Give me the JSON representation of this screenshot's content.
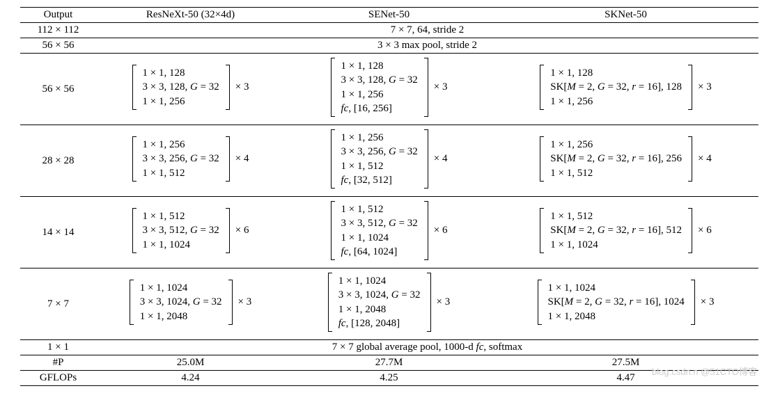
{
  "chart_data": {
    "type": "table",
    "columns": [
      "Output",
      "ResNeXt-50 (32×4d)",
      "SENet-50",
      "SKNet-50"
    ],
    "stem": {
      "output": "112 × 112",
      "op": "7 × 7, 64, stride 2"
    },
    "pool": {
      "output": "56 × 56",
      "op": "3 × 3 max pool, stride 2"
    },
    "stages": [
      {
        "output": "56 × 56",
        "repeat": 3,
        "resnext": [
          "1 × 1, 128",
          "3 × 3, 128, G = 32",
          "1 × 1, 256"
        ],
        "senet": [
          "1 × 1, 128",
          "3 × 3, 128, G = 32",
          "1 × 1, 256",
          "fc, [16, 256]"
        ],
        "sknet": [
          "1 × 1, 128",
          "SK[M = 2, G = 32, r = 16], 128",
          "1 × 1, 256"
        ]
      },
      {
        "output": "28 × 28",
        "repeat": 4,
        "resnext": [
          "1 × 1, 256",
          "3 × 3, 256, G = 32",
          "1 × 1, 512"
        ],
        "senet": [
          "1 × 1, 256",
          "3 × 3, 256, G = 32",
          "1 × 1, 512",
          "fc, [32, 512]"
        ],
        "sknet": [
          "1 × 1, 256",
          "SK[M = 2, G = 32, r = 16], 256",
          "1 × 1, 512"
        ]
      },
      {
        "output": "14 × 14",
        "repeat": 6,
        "resnext": [
          "1 × 1, 512",
          "3 × 3, 512, G = 32",
          "1 × 1, 1024"
        ],
        "senet": [
          "1 × 1, 512",
          "3 × 3, 512, G = 32",
          "1 × 1, 1024",
          "fc, [64, 1024]"
        ],
        "sknet": [
          "1 × 1, 512",
          "SK[M = 2, G = 32, r = 16], 512",
          "1 × 1, 1024"
        ]
      },
      {
        "output": "7 × 7",
        "repeat": 3,
        "resnext": [
          "1 × 1, 1024",
          "3 × 3, 1024, G = 32",
          "1 × 1, 2048"
        ],
        "senet": [
          "1 × 1, 1024",
          "3 × 3, 1024, G = 32",
          "1 × 1, 2048",
          "fc, [128, 2048]"
        ],
        "sknet": [
          "1 × 1, 1024",
          "SK[M = 2, G = 32, r = 16], 1024",
          "1 × 1, 2048"
        ]
      }
    ],
    "head": {
      "output": "1 × 1",
      "op": "7 × 7 global average pool, 1000-d fc, softmax"
    },
    "params_label": "#P",
    "params": {
      "resnext": "25.0M",
      "senet": "27.7M",
      "sknet": "27.5M"
    },
    "gflops_label": "GFLOPs",
    "gflops": {
      "resnext": "4.24",
      "senet": "4.25",
      "sknet": "4.47"
    }
  },
  "hdr": {
    "output": "Output",
    "resnext": "ResNeXt-50 (32×4d)",
    "senet": "SENet-50",
    "sknet": "SKNet-50"
  },
  "watermark": "blog.csdn.n    @51CTO博客"
}
